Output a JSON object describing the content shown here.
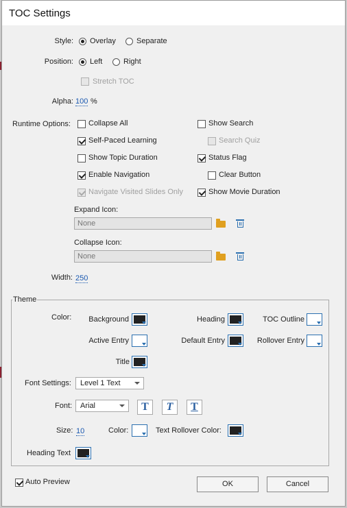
{
  "window": {
    "title": "TOC Settings"
  },
  "style": {
    "label": "Style:",
    "options": [
      "Overlay",
      "Separate"
    ],
    "selected": "Overlay"
  },
  "position": {
    "label": "Position:",
    "options": [
      "Left",
      "Right"
    ],
    "selected": "Left",
    "stretch_label": "Stretch TOC"
  },
  "alpha": {
    "label": "Alpha:",
    "value": "100",
    "unit": "%"
  },
  "runtime": {
    "label": "Runtime Options:",
    "collapse_all": "Collapse All",
    "self_paced": "Self-Paced Learning",
    "show_topic_duration": "Show Topic Duration",
    "enable_navigation": "Enable Navigation",
    "navigate_visited": "Navigate Visited Slides Only",
    "show_search": "Show Search",
    "search_quiz": "Search Quiz",
    "status_flag": "Status Flag",
    "clear_button": "Clear Button",
    "show_movie_duration": "Show Movie Duration"
  },
  "expand_icon": {
    "label": "Expand Icon:",
    "value": "None"
  },
  "collapse_icon": {
    "label": "Collapse Icon:",
    "value": "None"
  },
  "width": {
    "label": "Width:",
    "value": "250"
  },
  "theme": {
    "label": "Theme",
    "color_label": "Color:",
    "background": "Background",
    "heading": "Heading",
    "toc_outline": "TOC Outline",
    "active_entry": "Active Entry",
    "default_entry": "Default Entry",
    "rollover_entry": "Rollover Entry",
    "title": "Title",
    "font_settings_label": "Font Settings:",
    "font_settings_value": "Level 1 Text",
    "font_label": "Font:",
    "font_value": "Arial",
    "style_glyph": "T",
    "size_label": "Size:",
    "size_value": "10",
    "color2_label": "Color:",
    "text_rollover_label": "Text Rollover Color:",
    "heading_text_label": "Heading Text"
  },
  "auto_preview": {
    "label": "Auto Preview"
  },
  "buttons": {
    "ok": "OK",
    "cancel": "Cancel"
  },
  "colors": {
    "accent": "#2a6fb0",
    "link": "#1a58b0",
    "swatch_dark": "#222222"
  }
}
